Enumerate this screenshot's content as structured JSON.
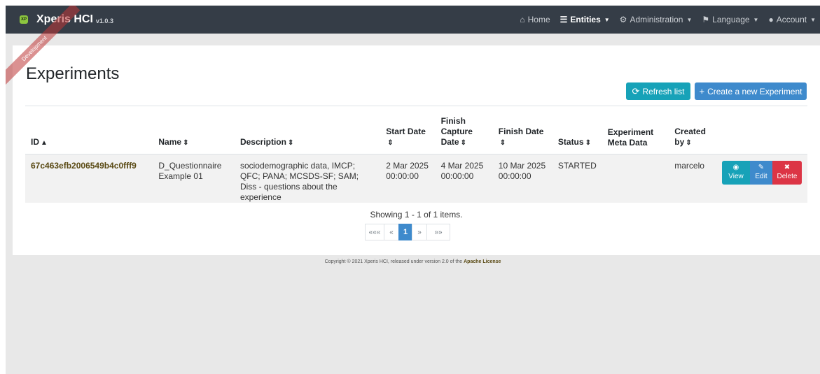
{
  "brand": {
    "logo_text": "XP",
    "title": "Xperis HCI",
    "version": "v1.0.3"
  },
  "ribbon": "Development",
  "nav": {
    "home": {
      "icon": "home-icon",
      "label": "Home"
    },
    "entities": {
      "icon": "list-icon",
      "label": "Entities"
    },
    "administration": {
      "icon": "users-cog-icon",
      "label": "Administration"
    },
    "language": {
      "icon": "flag-icon",
      "label": "Language"
    },
    "account": {
      "icon": "user-icon",
      "label": "Account"
    }
  },
  "page": {
    "title": "Experiments",
    "refresh_label": "Refresh list",
    "create_label": "Create a new Experiment"
  },
  "table": {
    "headers": {
      "id": "ID",
      "name": "Name",
      "description": "Description",
      "start_date": "Start Date",
      "finish_capture_date": "Finish Capture Date",
      "finish_date": "Finish Date",
      "status": "Status",
      "meta_data": "Experiment Meta Data",
      "created_by": "Created by"
    },
    "rows": [
      {
        "id": "67c463efb2006549b4c0fff9",
        "name": "D_Questionnaire Example 01",
        "description": "sociodemographic data, IMCP; QFC; PANA; MCSDS-SF; SAM; Diss - questions about the experience",
        "start_date": "2 Mar 2025 00:00:00",
        "finish_capture_date": "4 Mar 2025 00:00:00",
        "finish_date": "10 Mar 2025 00:00:00",
        "status": "STARTED",
        "meta_data": "",
        "created_by": "marcelo",
        "actions": {
          "view": "View",
          "edit": "Edit",
          "delete": "Delete"
        }
      }
    ]
  },
  "pagination": {
    "summary": "Showing 1 - 1 of 1 items.",
    "first": "«««",
    "prev": "«",
    "current": "1",
    "next": "»",
    "last": "»»"
  },
  "footer": {
    "text": "Copyright © 2021 Xperis HCI, released under version 2.0 of the",
    "link": "Apache License"
  },
  "colors": {
    "navbar": "#353d47",
    "info": "#17a2b8",
    "primary": "#3e8acc",
    "danger": "#dc3545",
    "link": "#5a4a14"
  }
}
